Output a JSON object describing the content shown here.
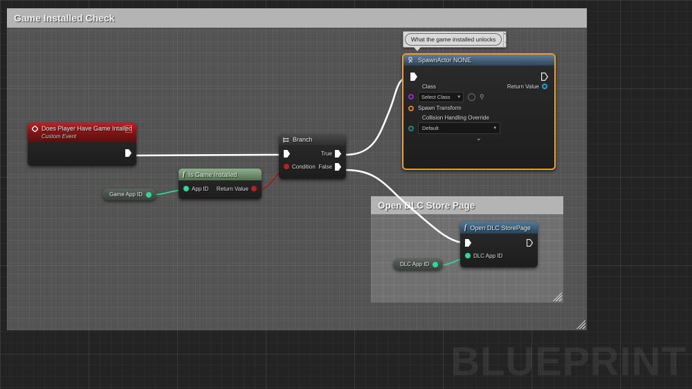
{
  "canvas": {
    "watermark": "BLUEPRINT",
    "background_color": "#232323",
    "grid_color": "#2e2e2e"
  },
  "comments": [
    {
      "id": "game-installed-check",
      "title": "Game Installed Check",
      "title_bar_color": "#b4b4b4",
      "body_color": "#969696"
    },
    {
      "id": "open-dlc-store-page",
      "title": "Open DLC Store Page",
      "title_bar_color": "#b4b4b4",
      "body_color": "#969696"
    }
  ],
  "bubble": {
    "text": "What the game installed unlocks",
    "pin_glyph": "⤡",
    "collapse_glyph": "−"
  },
  "nodes": {
    "custom_event": {
      "title": "Does Player Have Game Intalled",
      "subtitle": "Custom Event",
      "icon": "event-diamond-icon",
      "header_color": "#a01c1c",
      "delegate_pin": "delegate-output-pin",
      "out_exec_label": ""
    },
    "branch": {
      "title": "Branch",
      "icon": "branch-icon",
      "in_exec_label": "",
      "condition_label": "Condition",
      "true_label": "True",
      "false_label": "False",
      "condition_pin_color": "#b32222"
    },
    "is_game_installed": {
      "title": "Is Game Installed",
      "icon": "function-icon",
      "header_color": "#6f8f6f",
      "in_pin_label": "App ID",
      "out_pin_label": "Return Value",
      "in_pin_color": "#2fd89a",
      "out_pin_color": "#b32222"
    },
    "spawn_actor": {
      "title": "SpawnActor NONE",
      "icon": "spawn-actor-icon",
      "selected": true,
      "selection_color": "#f0a020",
      "class_label": "Class",
      "class_value": "Select Class",
      "class_pin_color": "#9b27d6",
      "browse_icon": "browse-asset-icon",
      "search_icon": "search-icon",
      "spawn_transform_label": "Spawn Transform",
      "spawn_transform_pin_color": "#e07d1e",
      "collision_label": "Collision Handling Override",
      "collision_value": "Default",
      "collision_pin_color": "#1d8c7e",
      "return_value_label": "Return Value",
      "return_value_pin_color": "#1ba6dd",
      "expand_glyph": "⌄"
    },
    "open_dlc_storepage": {
      "title": "Open DLC StorePage",
      "icon": "function-icon",
      "header_color": "#3b5a74",
      "in_pin_label": "DLC App ID",
      "in_pin_color": "#2fd89a"
    }
  },
  "variables": [
    {
      "id": "game-app-id",
      "label": "Game App ID",
      "pin_color": "#2fd89a"
    },
    {
      "id": "dlc-app-id",
      "label": "DLC App ID",
      "pin_color": "#2fd89a"
    }
  ],
  "wires": [
    {
      "id": "event-to-branch",
      "type": "exec",
      "color": "#ffffff"
    },
    {
      "id": "gameappid-to-isgameinstalled",
      "type": "data",
      "color": "#2fd89a"
    },
    {
      "id": "isgameinstalled-to-condition",
      "type": "data",
      "color": "#a81a1a"
    },
    {
      "id": "branch-true-to-spawnactor",
      "type": "exec",
      "color": "#ffffff"
    },
    {
      "id": "branch-false-to-opendlc",
      "type": "exec",
      "color": "#ffffff"
    },
    {
      "id": "dlcappid-to-opendlc",
      "type": "data",
      "color": "#2fd89a"
    }
  ]
}
